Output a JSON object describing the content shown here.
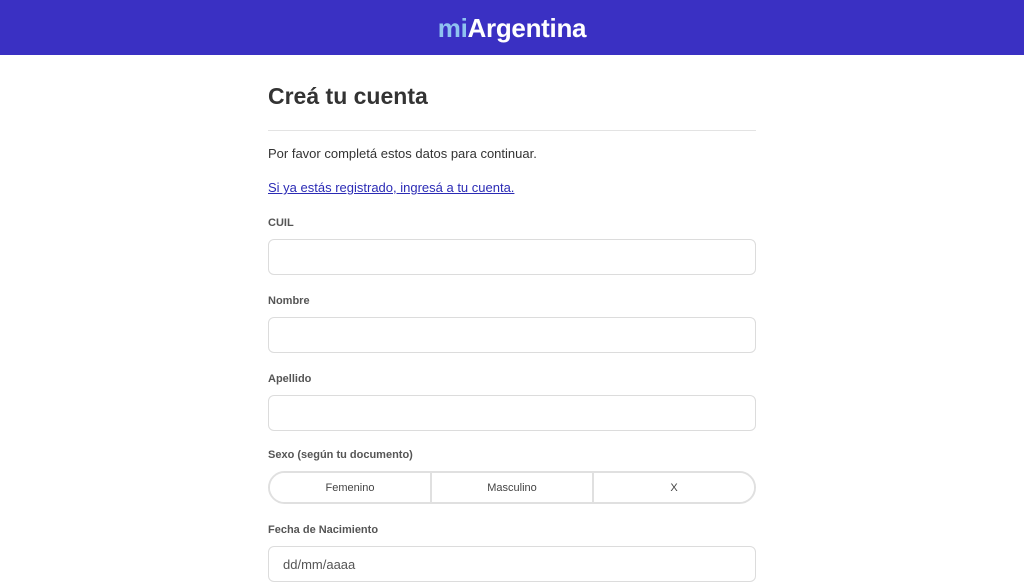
{
  "header": {
    "logo_prefix": "mi",
    "logo_main": "Argentina"
  },
  "page": {
    "title": "Creá tu cuenta",
    "intro": "Por favor completá estos datos para continuar.",
    "login_link": "Si ya estás registrado, ingresá a tu cuenta."
  },
  "form": {
    "cuil": {
      "label": "CUIL",
      "value": ""
    },
    "nombre": {
      "label": "Nombre",
      "value": ""
    },
    "apellido": {
      "label": "Apellido",
      "value": ""
    },
    "sexo": {
      "label": "Sexo (según tu documento)",
      "options": [
        "Femenino",
        "Masculino",
        "X"
      ]
    },
    "fecha": {
      "label": "Fecha de Nacimiento",
      "placeholder": "dd/mm/aaaa"
    }
  },
  "colors": {
    "header_bg": "#3a30c3",
    "logo_prefix": "#8fc3f0",
    "link": "#2b2bb5"
  }
}
